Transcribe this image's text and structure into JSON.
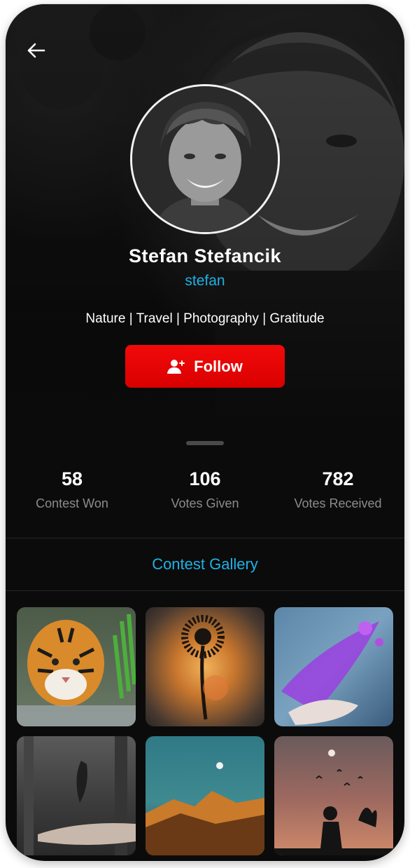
{
  "profile": {
    "name": "Stefan Stefancik",
    "handle": "stefan",
    "tags": "Nature | Travel | Photography | Gratitude"
  },
  "actions": {
    "back_icon": "arrow-left-icon",
    "follow_label": "Follow",
    "follow_icon": "add-user-icon"
  },
  "stats": [
    {
      "value": "58",
      "label": "Contest Won"
    },
    {
      "value": "106",
      "label": "Votes Given"
    },
    {
      "value": "782",
      "label": "Votes Received"
    }
  ],
  "gallery": {
    "title": "Contest Gallery",
    "items": [
      {
        "subject": "tiger"
      },
      {
        "subject": "dandelion-sunset"
      },
      {
        "subject": "purple-powder-hand"
      },
      {
        "subject": "feather-hand"
      },
      {
        "subject": "moon-mountain"
      },
      {
        "subject": "silhouette-birds"
      }
    ]
  },
  "colors": {
    "accent": "#1fb2e6",
    "follow": "#e60000",
    "background": "#0b0b0b"
  }
}
